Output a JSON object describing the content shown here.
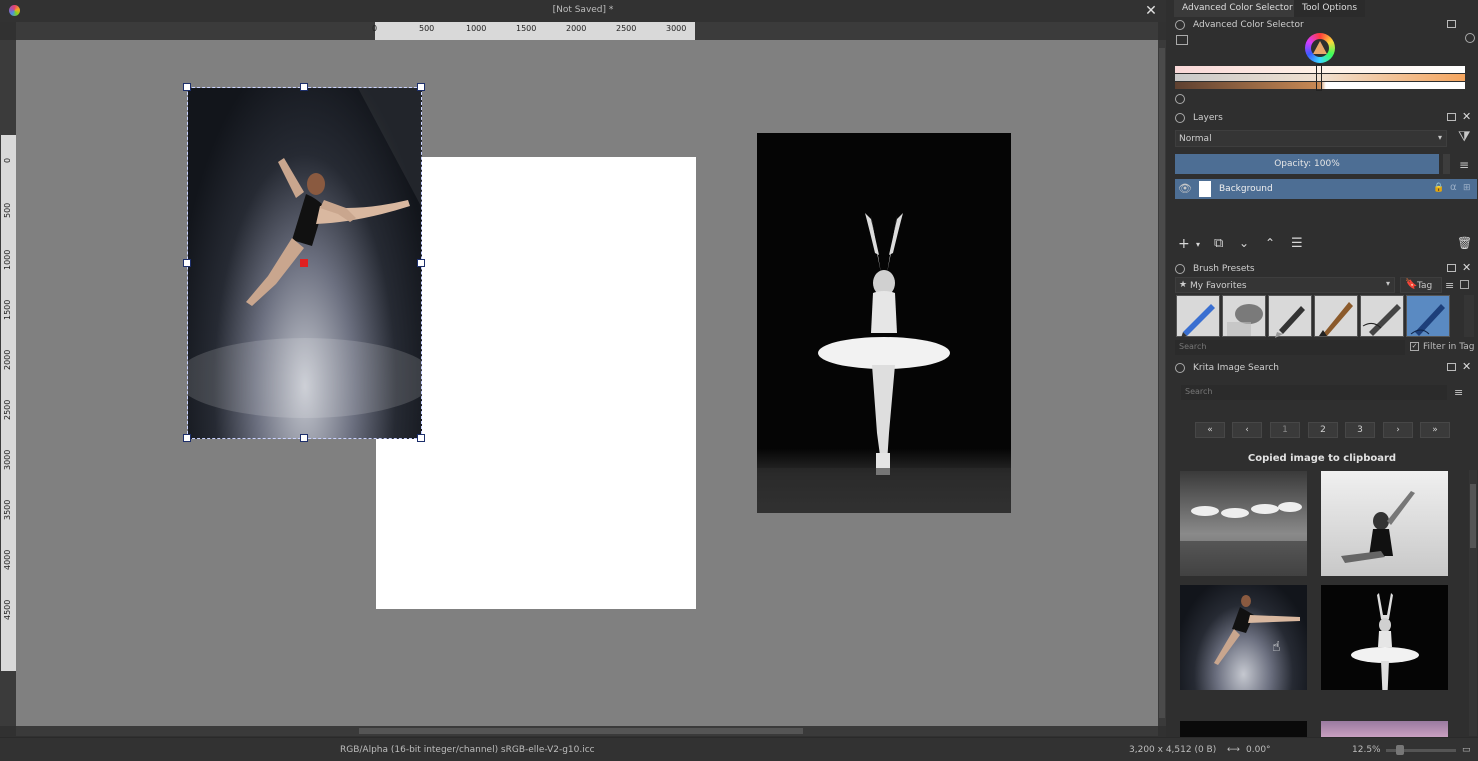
{
  "window": {
    "title": "[Not Saved]  *",
    "close_glyph": "✕"
  },
  "rulers": {
    "horizontal_ticks": [
      "0",
      "500",
      "1000",
      "1500",
      "2000",
      "2500",
      "3000"
    ],
    "vertical_ticks": [
      "0",
      "500",
      "1000",
      "1500",
      "2000",
      "2500",
      "3000",
      "3500",
      "4000",
      "4500"
    ]
  },
  "canvas": {
    "background": "#808080",
    "selection_color": "#1d2f6b",
    "center_handle_color": "#e02020"
  },
  "statusbar": {
    "color_profile": "RGB/Alpha (16-bit integer/channel)  sRGB-elle-V2-g10.icc",
    "image_size": "3,200 x 4,512 (0 B)",
    "rotation": "0.00°",
    "zoom": "12.5%"
  },
  "dock": {
    "tabs": [
      {
        "label": "Advanced Color Selector",
        "active": true
      },
      {
        "label": "Tool Options",
        "active": false
      }
    ],
    "color_selector": {
      "title": "Advanced Color Selector"
    },
    "layers": {
      "title": "Layers",
      "blend_mode": "Normal",
      "opacity": "Opacity:  100%",
      "items": [
        {
          "name": "Background",
          "selected": true
        }
      ]
    },
    "brush_presets": {
      "title": "Brush Presets",
      "tag_filter": "My Favorites",
      "tag_button": "Tag",
      "search_placeholder": "Search",
      "filter_in_tag": "Filter in Tag",
      "presets": [
        "blue-pencil",
        "eraser-round",
        "fountain-pen",
        "ink-brush",
        "fine-liner",
        "calligraphy-pen"
      ],
      "selected_index": 5
    },
    "image_search": {
      "title": "Krita Image Search",
      "search_placeholder": "Search",
      "pages": [
        "«",
        "‹",
        "1",
        "2",
        "3",
        "›",
        "»"
      ],
      "status_message": "Copied image to clipboard",
      "results": [
        "ballet-corps-bw",
        "ballerina-pose-bw",
        "dancer-leap",
        "swan-dancer",
        "dark-image",
        "pink-sky-image"
      ]
    },
    "colors": {
      "accent": "#4d6e94",
      "panel": "#2f2f2f",
      "selected_brush": "#5a8ac2"
    }
  }
}
